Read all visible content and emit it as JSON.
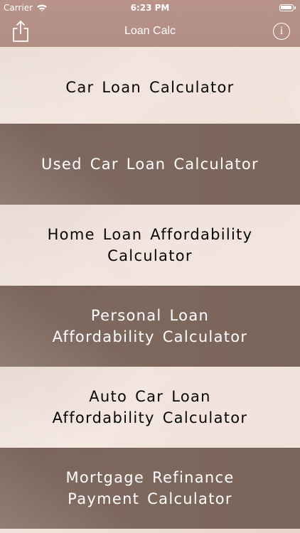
{
  "status_bar": {
    "carrier": "Carrier",
    "time": "6:23 PM",
    "wifi_icon": "wifi-icon",
    "battery_icon": "battery-icon"
  },
  "navigation": {
    "title": "Loan Calc",
    "left_icon": "share-icon",
    "right_icon": "info-icon",
    "info_symbol": "i"
  },
  "calculators": [
    {
      "label": "Car Loan Calculator"
    },
    {
      "label": "Used Car Loan Calculator"
    },
    {
      "label": "Home Loan Affordability Calculator"
    },
    {
      "label": "Personal Loan Affordability Calculator"
    },
    {
      "label": "Auto Car Loan Affordability Calculator"
    },
    {
      "label": "Mortgage Refinance Payment Calculator"
    }
  ],
  "colors": {
    "nav_background": "#b18d84",
    "light_row": "#f4e8e0",
    "dark_row": "#7a655b",
    "light_text": "#050505",
    "dark_text": "#ffffff"
  }
}
